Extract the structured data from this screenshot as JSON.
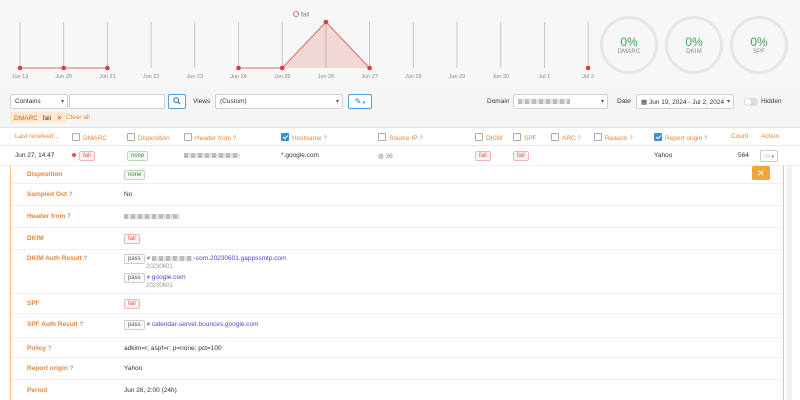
{
  "chart": {
    "x_labels": [
      "Jun 19",
      "Jun 20",
      "Jun 21",
      "Jun 22",
      "Jun 23",
      "Jun 24",
      "Jun 25",
      "Jun 26",
      "Jun 27",
      "Jun 28",
      "Jun 29",
      "Jun 30",
      "Jul 1",
      "Jul 2"
    ],
    "legend_label": "fail",
    "series_color": "#e26a6a"
  },
  "chart_data": {
    "type": "area",
    "x": [
      "Jun 19",
      "Jun 20",
      "Jun 21",
      "Jun 22",
      "Jun 23",
      "Jun 24",
      "Jun 25",
      "Jun 26",
      "Jun 27",
      "Jun 28",
      "Jun 29",
      "Jun 30",
      "Jul 1",
      "Jul 2"
    ],
    "series": [
      {
        "name": "fail",
        "values": [
          0,
          0,
          0,
          null,
          null,
          0,
          0,
          564,
          0,
          null,
          null,
          null,
          null,
          0
        ]
      }
    ],
    "grid": false
  },
  "gauges": [
    {
      "value": "0%",
      "label": "DMARC"
    },
    {
      "value": "0%",
      "label": "DKIM"
    },
    {
      "value": "0%",
      "label": "SPF"
    }
  ],
  "filters": {
    "match_mode": "Contains",
    "search_value": "",
    "views_label": "Views",
    "views_value": "(Custom)",
    "domain_label": "Domain",
    "date_label": "Date",
    "date_range": "Jun 19, 2024 - Jul 2, 2024",
    "hidden_label": "Hidden",
    "active_chip_key": "DMARC",
    "active_chip_value": "fail",
    "clear_all": "Clear all"
  },
  "table": {
    "headers": {
      "last_received": "Last received...",
      "dmarc": "DMARC",
      "disposition": "Disposition",
      "header_from": "Header from",
      "hostname": "Hostname",
      "source_ip": "Source IP",
      "dkim": "DKIM",
      "spf": "SPF",
      "arc": "ARC",
      "reason": "Reason",
      "report_origin": "Report origin",
      "count": "Count",
      "action": "Action"
    },
    "row": {
      "last_received": "Jun 27, 14:47",
      "dmarc": "fail",
      "disposition": "none",
      "hostname": "*.google.com",
      "source_ip": "36",
      "dkim": "fail",
      "spf": "fail",
      "report_origin": "Yahoo",
      "count": "564"
    }
  },
  "detail": {
    "disposition_key": "Disposition",
    "disposition_val": "none",
    "sampled_out_key": "Sampled Out",
    "sampled_out_val": "No",
    "header_from_key": "Header from",
    "dkim_key": "DKIM",
    "dkim_val": "fail",
    "dkim_auth_key": "DKIM Auth Result",
    "dkim1_status": "pass",
    "dkim1_domain": "-com.20230601.gappssmtp.com",
    "dkim1_sub": "20230601",
    "dkim2_status": "pass",
    "dkim2_domain": "google.com",
    "dkim2_sub": "20230601",
    "spf_key": "SPF",
    "spf_val": "fail",
    "spf_auth_key": "SPF Auth Result",
    "spf_auth_status": "pass",
    "spf_auth_domain": "calendar-server.bounces.google.com",
    "policy_key": "Policy",
    "policy_val": "adkim=r; aspf=r; p=none; pct=100",
    "report_origin_key": "Report origin",
    "report_origin_val": "Yahoo",
    "period_key": "Period",
    "period_val": "Jun 26, 2:00 (24h)"
  }
}
